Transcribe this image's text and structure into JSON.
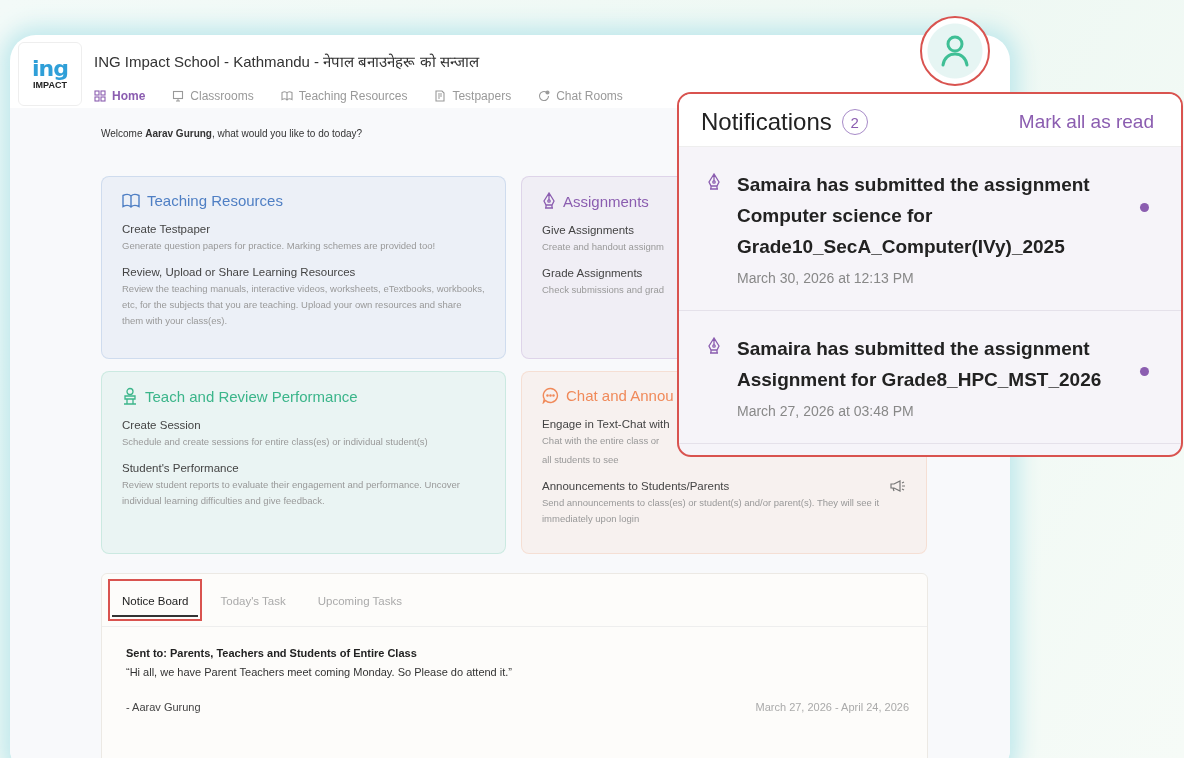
{
  "header": {
    "school": "ING Impact School - Kathmandu - नेपाल बनाउनेहरू को सन्जाल",
    "logo_top": "ing",
    "logo_bottom": "IMPACT"
  },
  "nav": [
    {
      "label": "Home",
      "kind": "grid",
      "selected": true
    },
    {
      "label": "Classrooms",
      "kind": "board",
      "selected": false
    },
    {
      "label": "Teaching Resources",
      "kind": "book",
      "selected": false
    },
    {
      "label": "Testpapers",
      "kind": "paper",
      "selected": false
    },
    {
      "label": "Chat Rooms",
      "kind": "chat",
      "selected": false
    }
  ],
  "welcome": {
    "before": "Welcome **Aarav Gurung**, what would you like to do today?"
  },
  "cards": [
    {
      "kind": "resources",
      "title": "Teaching Resources",
      "color": "#4f7fc4",
      "items": [
        {
          "kind": "plain",
          "title": "Create Testpaper",
          "desc": "Generate question papers for practice. Marking schemes are provided too!"
        },
        {
          "kind": "plain",
          "title": "Review, Upload or Share Learning Resources",
          "desc": "Review the teaching manuals, interactive videos, worksheets, eTextbooks, workbooks, etc, for the subjects that you are teaching. Upload your own resources and share them with your class(es)."
        }
      ]
    },
    {
      "kind": "assignments",
      "title": "Assignments",
      "color": "#8b5db0",
      "items": [
        {
          "kind": "plain",
          "title": "Give Assignments",
          "desc": "Create and handout assignm"
        },
        {
          "kind": "plain",
          "title": "Grade Assignments",
          "desc": "Check submissions and grad"
        }
      ]
    },
    {
      "kind": "performance",
      "title": "Teach and Review Performance",
      "color": "#3bb58a",
      "items": [
        {
          "kind": "plain",
          "title": "Create Session",
          "desc": "Schedule and create sessions for entire class(es) or individual student(s)"
        },
        {
          "kind": "plain",
          "title": "Student's Performance",
          "desc": "Review student reports to evaluate their engagement and performance. Uncover individual learning difficulties and give feedback."
        }
      ]
    },
    {
      "kind": "chat",
      "title": "Chat and Annou",
      "color": "#f08a5a",
      "items": [
        {
          "kind": "plain",
          "title": "Engage in Text-Chat with",
          "desc": "Chat with the entire class or",
          "desc_more": "all students to see"
        },
        {
          "kind": "announce",
          "title": "Announcements to Students/Parents",
          "desc": "Send announcements to class(es) or student(s) and/or parent(s). They will see it immediately upon login"
        }
      ]
    }
  ],
  "notice": {
    "tabs": [
      {
        "label": "Notice Board",
        "selected": true
      },
      {
        "label": "Today's Task",
        "selected": false
      },
      {
        "label": "Upcoming Tasks",
        "selected": false
      }
    ],
    "sent_to": "Sent to: Parents, Teachers and Students of Entire Class",
    "message": "“Hi all, we have Parent Teachers meet coming Monday. So Please do attend it.”",
    "author": "- Aarav Gurung",
    "dates": "March 27, 2026 - April 24, 2026"
  },
  "notifications": {
    "title": "Notifications",
    "count": "2",
    "mark_all": "Mark all as read",
    "items": [
      {
        "text": "Samaira has submitted the assignment Computer science for Grade10_SecA_Computer(IVy)_2025",
        "time": "March 30, 2026 at 12:13 PM",
        "unread": true
      },
      {
        "text": "Samaira has submitted the assignment Assignment for Grade8_HPC_MST_2026",
        "time": "March 27, 2026 at 03:48 PM",
        "unread": true
      }
    ]
  }
}
